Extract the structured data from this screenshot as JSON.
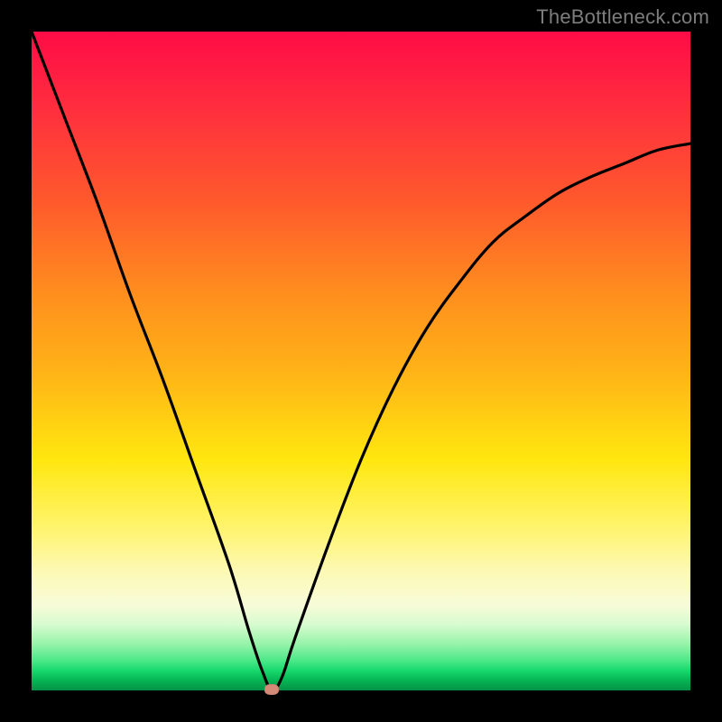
{
  "watermark": "TheBottleneck.com",
  "colors": {
    "frame": "#000000",
    "curve": "#000000",
    "dot": "#d58a78",
    "gradient_top": "#ff0b46",
    "gradient_bottom": "#059245"
  },
  "chart_data": {
    "type": "line",
    "title": "",
    "xlabel": "",
    "ylabel": "",
    "xlim": [
      0,
      100
    ],
    "ylim": [
      0,
      100
    ],
    "annotations": [],
    "series": [
      {
        "name": "bottleneck-curve",
        "x": [
          0,
          5,
          10,
          15,
          20,
          25,
          30,
          33,
          35,
          36.5,
          38,
          40,
          45,
          50,
          55,
          60,
          65,
          70,
          75,
          80,
          85,
          90,
          95,
          100
        ],
        "y": [
          100,
          87,
          74,
          60,
          47,
          33,
          19,
          9,
          3,
          0,
          2,
          8,
          22,
          35,
          46,
          55,
          62,
          68,
          72,
          75.5,
          78,
          80,
          82,
          83
        ]
      }
    ],
    "minimum_point": {
      "x": 36.5,
      "y": 0
    }
  }
}
